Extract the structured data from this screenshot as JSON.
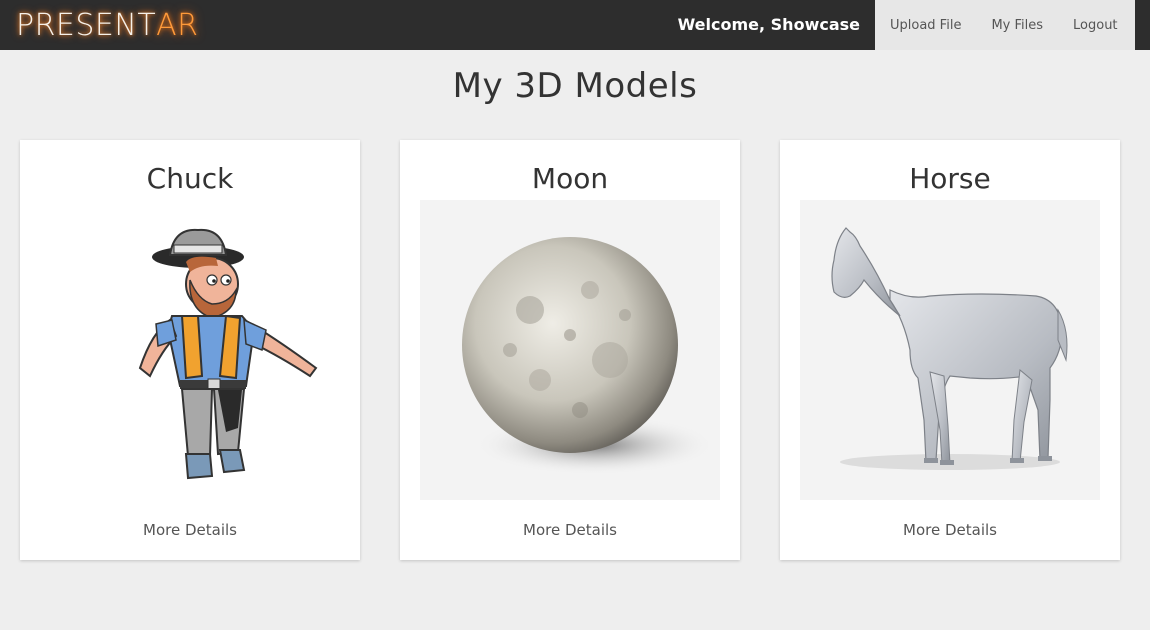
{
  "header": {
    "brand_left": "PRESENT",
    "brand_right": "AR",
    "welcome": "Welcome, Showcase",
    "links": [
      "Upload File",
      "My Files",
      "Logout"
    ]
  },
  "page": {
    "title": "My 3D Models"
  },
  "models": [
    {
      "name": "Chuck",
      "link": "More Details",
      "image": "cartoon-cowboy-figure"
    },
    {
      "name": "Moon",
      "link": "More Details",
      "image": "moon-sphere"
    },
    {
      "name": "Horse",
      "link": "More Details",
      "image": "grey-horse-statue"
    }
  ],
  "colors": {
    "navbar": "#2d2d2d",
    "nav_right_bg": "#e7e7e7",
    "brand_glow": "#ff8c2a",
    "page_bg": "#eeeeee",
    "card_bg": "#ffffff"
  }
}
